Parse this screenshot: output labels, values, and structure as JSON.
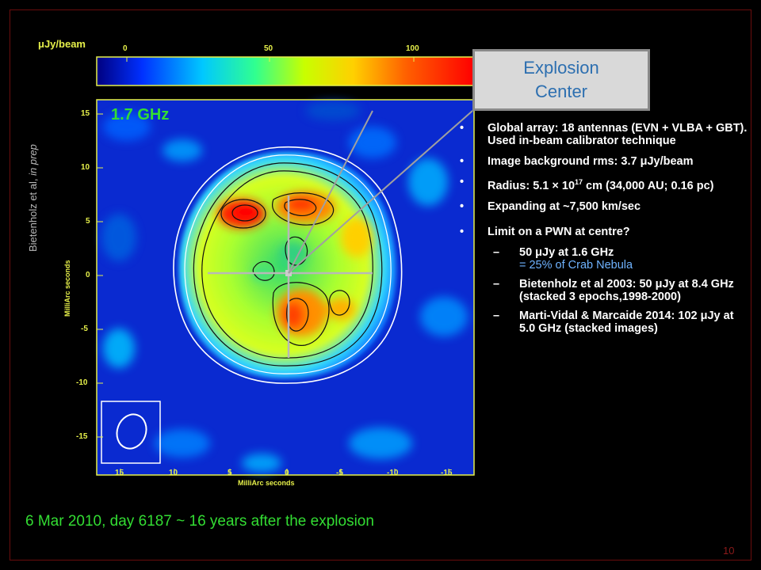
{
  "colorbar": {
    "title": "μJy/beam",
    "ticks": [
      "0",
      "50",
      "100"
    ]
  },
  "credit": {
    "authors": "Bietenholz et al, ",
    "status": "in prep"
  },
  "image": {
    "frequency_label": "1.7 GHz",
    "y_axis_label": "MilliArc seconds",
    "x_axis_label": "MilliArc seconds",
    "y_ticks": [
      "15",
      "10",
      "5",
      "0",
      "-5",
      "-10",
      "-15"
    ],
    "x_ticks": [
      "15",
      "10",
      "5",
      "0",
      "-5",
      "-10",
      "-15"
    ]
  },
  "callout": {
    "line1": "Explosion",
    "line2": "Center"
  },
  "bullets": [
    "Global array:  18 antennas (EVN + VLBA + GBT).  Used in-beam calibrator technique",
    "Image background rms: 3.7 μJy/beam",
    {
      "pre": "Radius:  5.1 × 10",
      "sup": "17",
      "post": " cm (34,000 AU; 0.16 pc)"
    },
    "Expanding at ~7,500 km/sec",
    "Limit on a PWN at centre?"
  ],
  "sub_bullets": [
    {
      "line": "50 μJy at 1.6 GHz",
      "note": "= 25% of Crab Nebula"
    },
    "Bietenholz et al 2003: 50 μJy at 8.4 GHz (stacked 3 epochs,1998-2000)",
    "Marti-Vidal & Marcaide 2014: 102 μJy at 5.0 GHz (stacked images)"
  ],
  "bottom_caption": "6 Mar 2010,  day  6187  ~ 16  years after the explosion",
  "page_number": "10",
  "colors": {
    "accent_green": "#33dd33",
    "axis_yellow": "#e6f04a",
    "callout_text": "#2d6fb0",
    "callout_bg": "#d9d9d9"
  }
}
